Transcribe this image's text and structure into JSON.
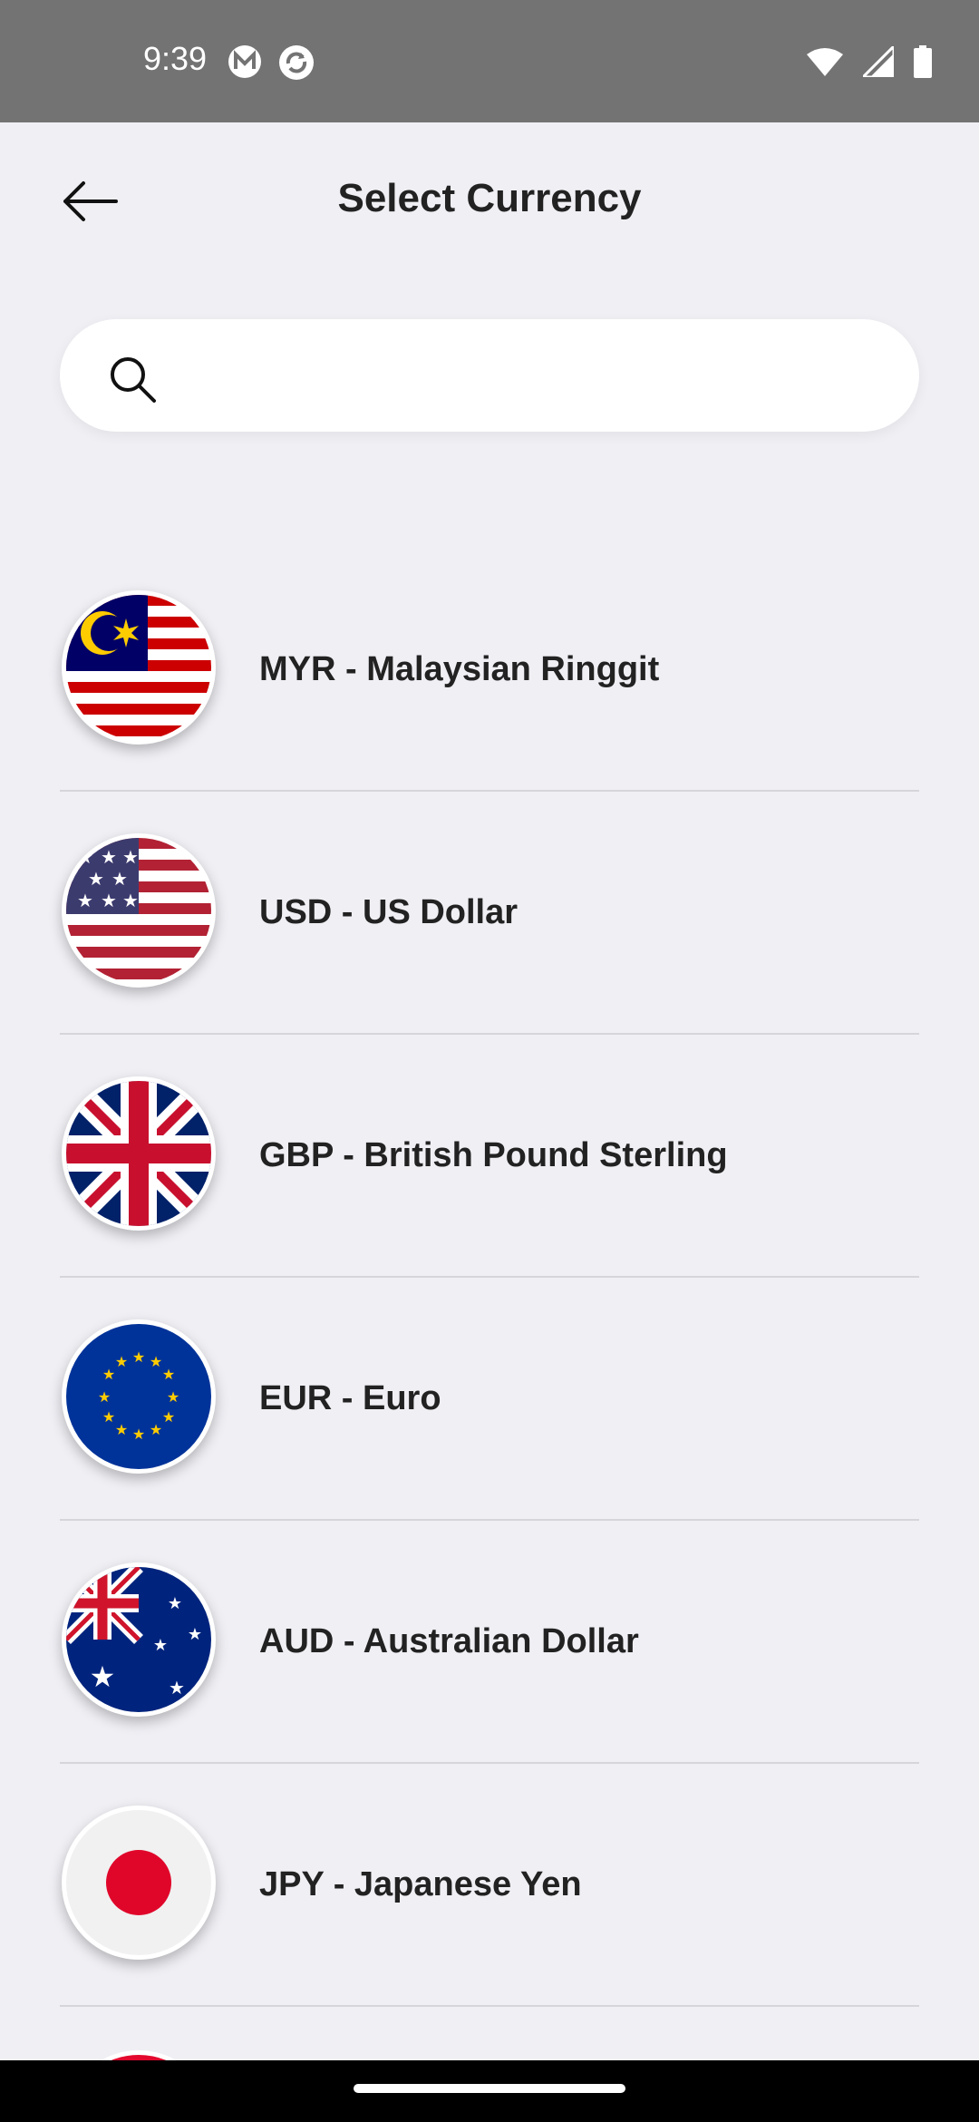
{
  "status_bar": {
    "time": "9:39"
  },
  "header": {
    "title": "Select Currency"
  },
  "search": {
    "value": "",
    "placeholder": ""
  },
  "currencies": [
    {
      "label": "MYR - Malaysian Ringgit",
      "flag": "malaysia-flag-icon"
    },
    {
      "label": "USD - US Dollar",
      "flag": "usa-flag-icon"
    },
    {
      "label": "GBP - British Pound Sterling",
      "flag": "uk-flag-icon"
    },
    {
      "label": "EUR - Euro",
      "flag": "eu-flag-icon"
    },
    {
      "label": "AUD - Australian Dollar",
      "flag": "australia-flag-icon"
    },
    {
      "label": "JPY - Japanese Yen",
      "flag": "japan-flag-icon"
    }
  ],
  "colors": {
    "background": "#efeff4",
    "status_bar": "#737373",
    "divider": "#d6d6da"
  }
}
